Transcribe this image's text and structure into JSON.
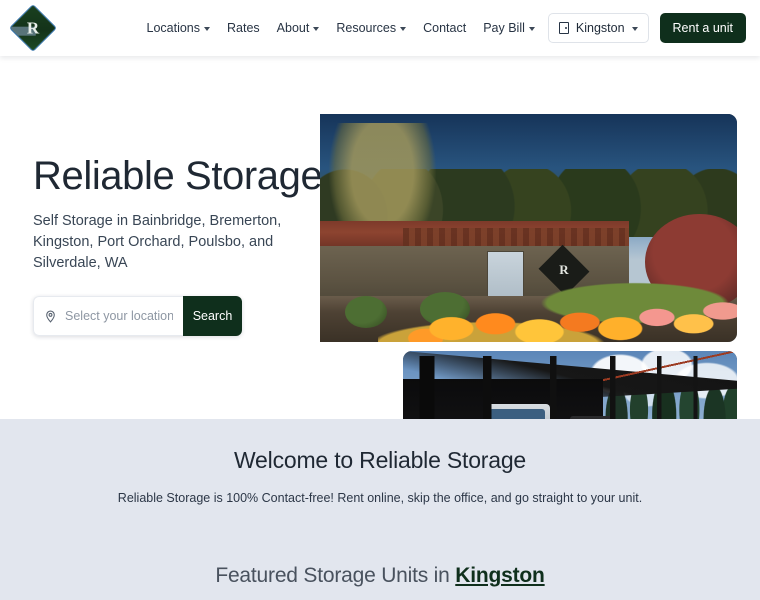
{
  "brand": {
    "logo_name": "reliable-storage-logo",
    "accent_green": "#0f2f1c",
    "band_bg": "#e2e6ee"
  },
  "nav": {
    "items": [
      {
        "label": "Locations",
        "has_caret": true
      },
      {
        "label": "Rates",
        "has_caret": false
      },
      {
        "label": "About",
        "has_caret": true
      },
      {
        "label": "Resources",
        "has_caret": true
      },
      {
        "label": "Contact",
        "has_caret": false
      },
      {
        "label": "Pay Bill",
        "has_caret": true
      }
    ],
    "location_select": {
      "value": "Kingston"
    },
    "rent_button": "Rent a unit"
  },
  "hero": {
    "title": "Reliable Storage",
    "subtitle": "Self Storage in Bainbridge, Bremerton, Kingston, Port Orchard, Poulsbo, and Silverdale, WA",
    "search": {
      "placeholder": "Select your location",
      "value": "",
      "button": "Search"
    },
    "photos": [
      {
        "alt": "Storage facility office building with flower garden"
      },
      {
        "alt": "Covered RV and vehicle storage canopy"
      }
    ]
  },
  "welcome": {
    "title": "Welcome to Reliable Storage",
    "subtitle": "Reliable Storage is 100% Contact-free! Rent online, skip the office, and go straight to your unit."
  },
  "featured": {
    "prefix": "Featured Storage Units in ",
    "city": "Kingston"
  }
}
